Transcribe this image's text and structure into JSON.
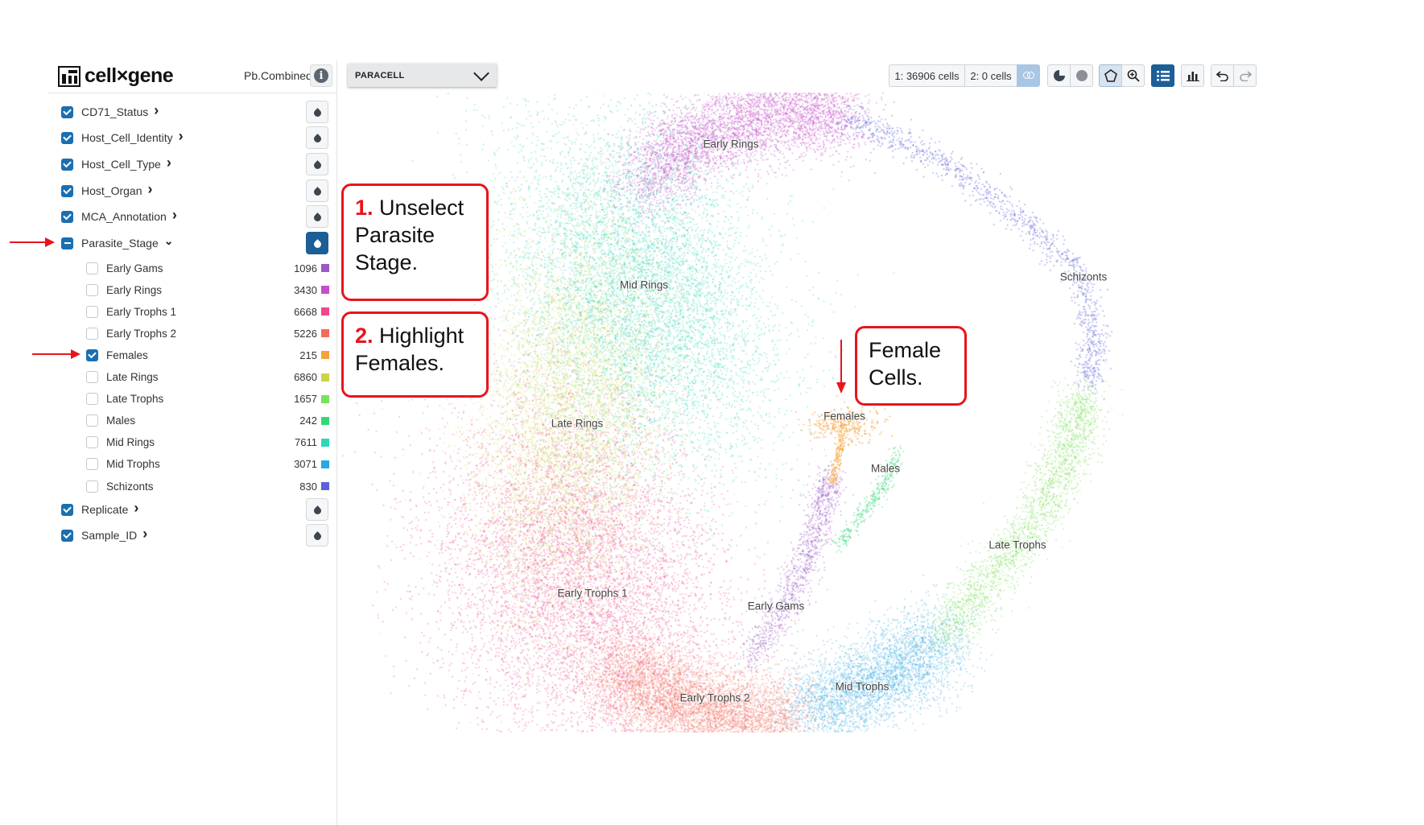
{
  "app": {
    "logo_text": "cell×gene",
    "dataset": "Pb.Combined"
  },
  "categories_top": [
    {
      "label": "CD71_Status",
      "state": "checked"
    },
    {
      "label": "Host_Cell_Identity",
      "state": "checked"
    },
    {
      "label": "Host_Cell_Type",
      "state": "checked"
    },
    {
      "label": "Host_Organ",
      "state": "checked"
    },
    {
      "label": "MCA_Annotation",
      "state": "checked"
    },
    {
      "label": "Parasite_Stage",
      "state": "indeterminate",
      "expanded": true
    }
  ],
  "parasite_stage_values": [
    {
      "label": "Early Gams",
      "count": "1096",
      "color": "#9b59c6",
      "checked": false
    },
    {
      "label": "Early Rings",
      "count": "3430",
      "color": "#c44fc8",
      "checked": false
    },
    {
      "label": "Early Trophs 1",
      "count": "6668",
      "color": "#f0478e",
      "checked": false
    },
    {
      "label": "Early Trophs 2",
      "count": "5226",
      "color": "#f26b5b",
      "checked": false
    },
    {
      "label": "Females",
      "count": "215",
      "color": "#f5a23a",
      "checked": true
    },
    {
      "label": "Late Rings",
      "count": "6860",
      "color": "#c9d44a",
      "checked": false
    },
    {
      "label": "Late Trophs",
      "count": "1657",
      "color": "#7ee05a",
      "checked": false
    },
    {
      "label": "Males",
      "count": "242",
      "color": "#34d67a",
      "checked": false
    },
    {
      "label": "Mid Rings",
      "count": "7611",
      "color": "#2fd5b8",
      "checked": false
    },
    {
      "label": "Mid Trophs",
      "count": "3071",
      "color": "#2aa6e0",
      "checked": false
    },
    {
      "label": "Schizonts",
      "count": "830",
      "color": "#5b63d8",
      "checked": false
    }
  ],
  "categories_bottom": [
    {
      "label": "Replicate",
      "state": "checked"
    },
    {
      "label": "Sample_ID",
      "state": "checked"
    }
  ],
  "toolbar": {
    "embedding": "PARACELL",
    "selection1": "1: 36906 cells",
    "selection2": "2: 0 cells"
  },
  "cluster_labels": [
    "Early Rings",
    "Mid Rings",
    "Late Rings",
    "Early Trophs 1",
    "Early Trophs 2",
    "Mid Trophs",
    "Late Trophs",
    "Schizonts",
    "Early Gams",
    "Females",
    "Males"
  ],
  "callouts": {
    "step1_num": "1.",
    "step1_text": "Unselect Parasite Stage.",
    "step2_num": "2.",
    "step2_text": "Highlight Females.",
    "female_text": "Female Cells."
  },
  "colors": {
    "accent": "#1c5e96",
    "annotation_red": "#e8141c"
  }
}
